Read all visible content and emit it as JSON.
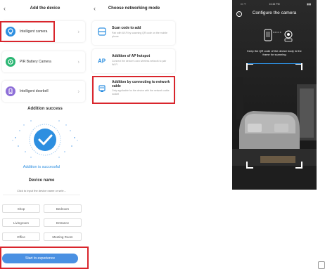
{
  "panel1": {
    "title": "Add the device",
    "devices": [
      {
        "label": "Intelligent camera",
        "icon": "camera-icon",
        "color": "#2d8fe0"
      },
      {
        "label": "PIR Battery Camera",
        "icon": "battery-camera-icon",
        "color": "#2bb673"
      },
      {
        "label": "Intelligent doorbell",
        "icon": "doorbell-icon",
        "color": "#8e6fd8"
      }
    ],
    "success_title": "Addition success",
    "success_text": "Addition is successful",
    "name_title": "Device name",
    "name_placeholder": "Click to input the device name or sele...",
    "rooms": [
      "Shop",
      "Bedroom",
      "Livingroom",
      "Entrance",
      "Office",
      "Meeting Room"
    ],
    "start_button": "Start to experience"
  },
  "panel2": {
    "title": "Choose networking mode",
    "modes": [
      {
        "title": "Scan code to add",
        "desc": "Pair with Wi-Fi by scanning QR code on the mobile phone",
        "icon": "scan-icon"
      },
      {
        "title": "Addition of AP hotspot",
        "desc": "Connect the device's own wireless network to pair Wi-Fi",
        "icon": "ap-icon",
        "icon_text": "AP"
      },
      {
        "title": "Addition by connecting to network cable",
        "desc": "Only applicable for the device with the network cable socket",
        "icon": "network-cable-icon"
      }
    ]
  },
  "panel3": {
    "status_left": "▪▪▪ ᯤ",
    "status_time": "10:43 PM",
    "status_right": "▮▮▮",
    "title": "Configure the camera",
    "hint": "Keep the QR code of the device body in the frame for scanning"
  },
  "colors": {
    "accent": "#2d8fe0",
    "highlight": "#d9252c",
    "button": "#4a90e2"
  }
}
